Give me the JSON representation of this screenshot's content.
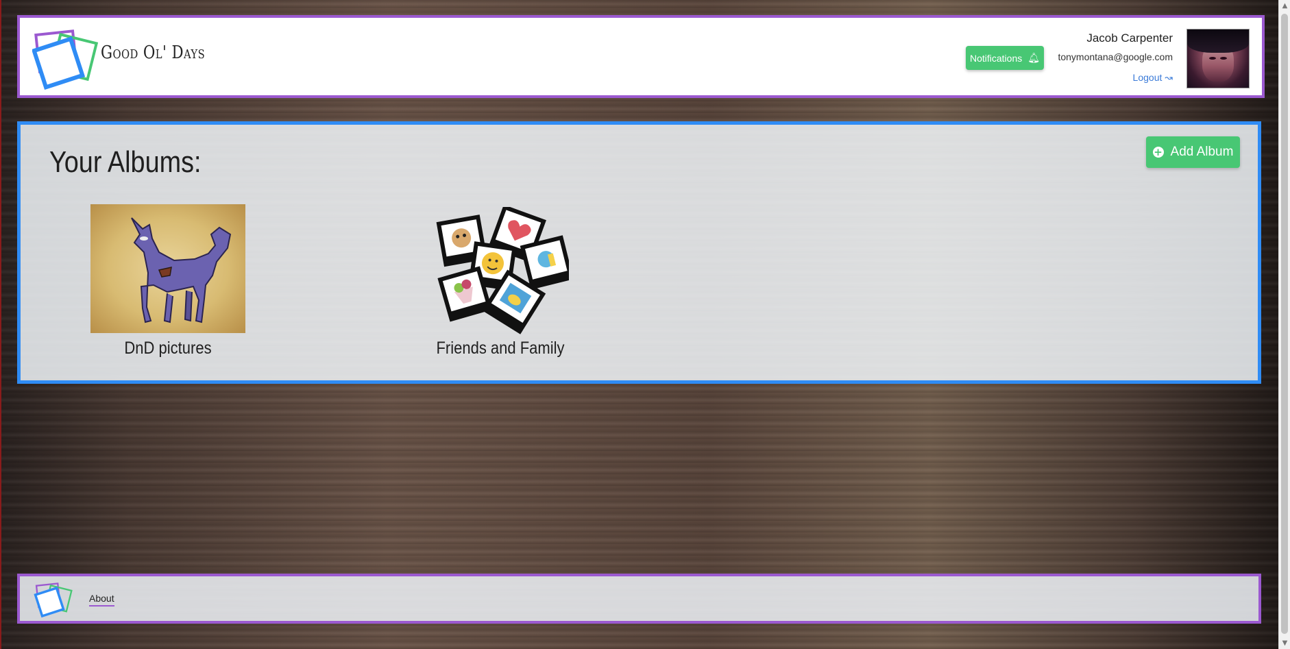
{
  "header": {
    "brand": "Good Ol' Days",
    "notifications_label": "Notifications",
    "user": {
      "name": "Jacob Carpenter",
      "email": "tonymontana@google.com",
      "logout_label": "Logout"
    }
  },
  "main": {
    "title": "Your Albums:",
    "add_album_label": "Add Album",
    "albums": [
      {
        "name": "DnD pictures"
      },
      {
        "name": "Friends and Family"
      }
    ]
  },
  "footer": {
    "about_label": "About"
  },
  "colors": {
    "header_border": "#9b59d0",
    "main_border": "#2f8cf5",
    "button_green": "#48c774",
    "link_blue": "#3b7bd8"
  },
  "icons": [
    "logo-icon",
    "bell-icon",
    "logout-arrow-icon",
    "plus-circle-icon"
  ]
}
